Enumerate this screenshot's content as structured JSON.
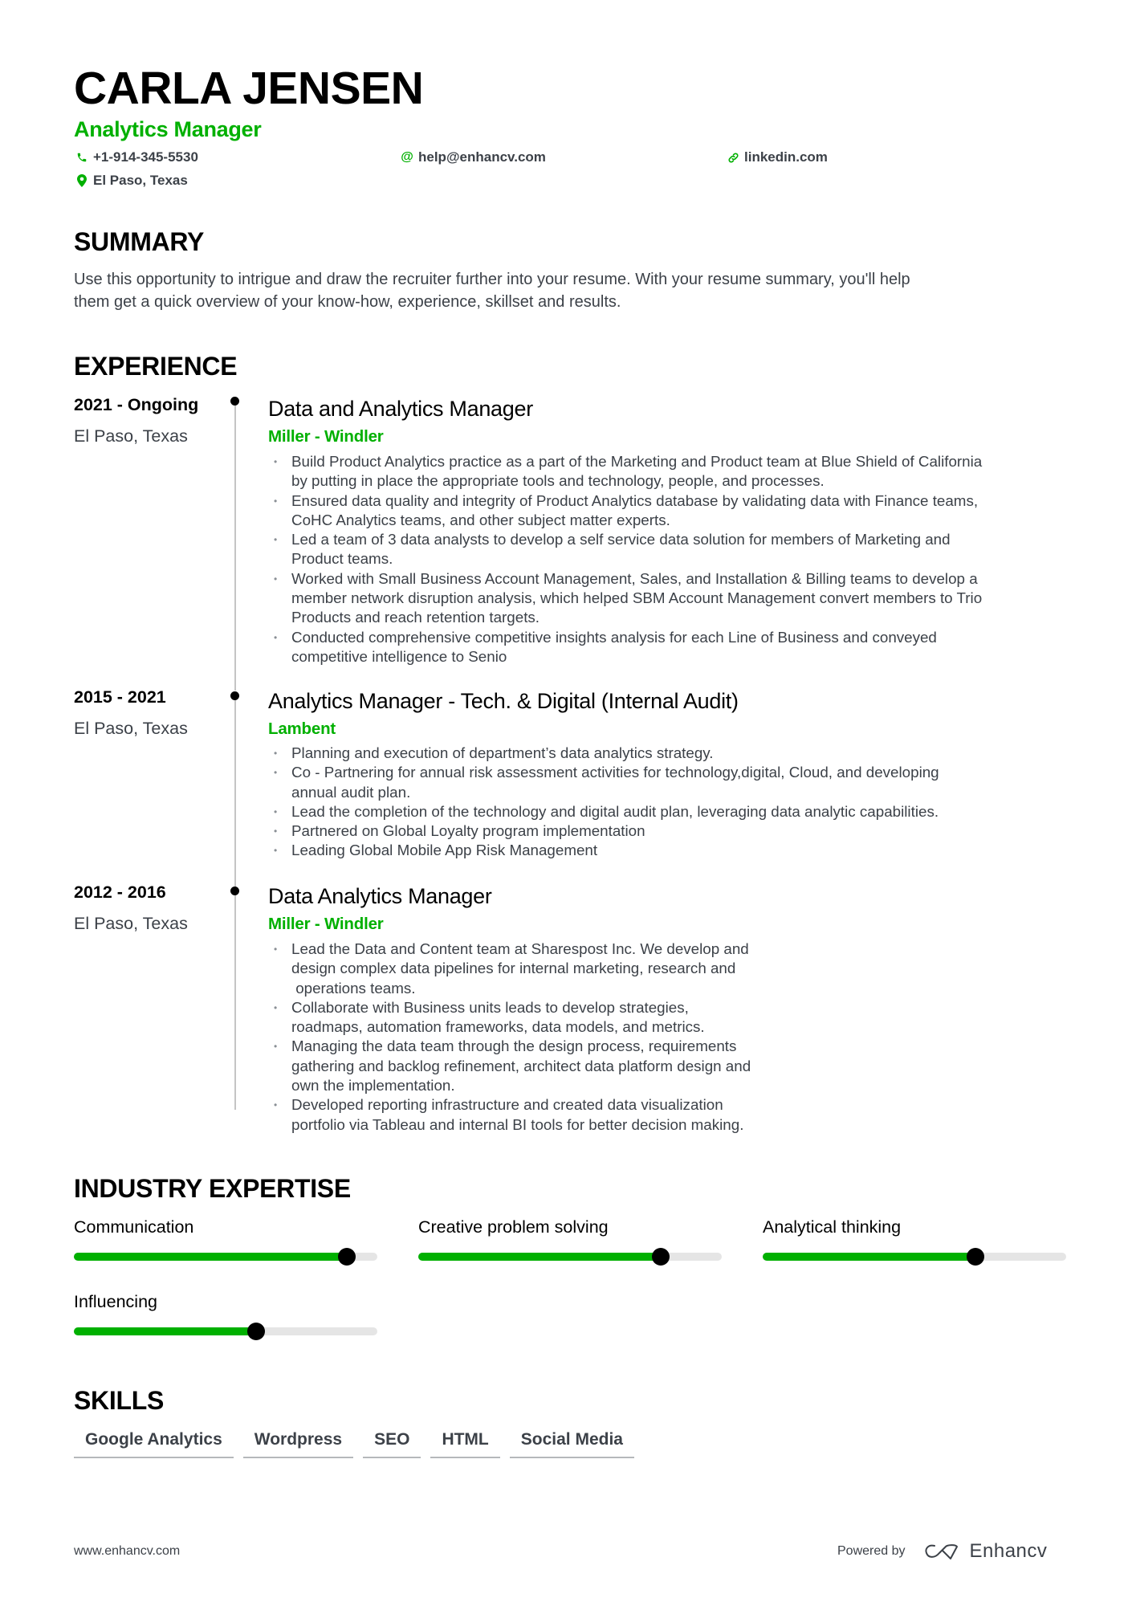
{
  "header": {
    "name": "CARLA JENSEN",
    "title": "Analytics Manager",
    "contacts": {
      "phone": "+1-914-345-5530",
      "email": "help@enhancv.com",
      "linkedin": "linkedin.com",
      "location": "El Paso, Texas"
    },
    "icons": {
      "phone": "phone-icon",
      "email": "at-icon",
      "linkedin": "link-icon",
      "location": "map-pin-icon"
    }
  },
  "summary": {
    "heading": "SUMMARY",
    "lines": [
      "Use this opportunity to intrigue and draw the recruiter further into your resume. With your resume summary, you'll help",
      "them get a quick overview of your know-how, experience, skillset and results."
    ]
  },
  "experience": {
    "heading": "EXPERIENCE",
    "items": [
      {
        "dates": "2021 - Ongoing",
        "location": "El Paso, Texas",
        "title": "Data and Analytics Manager",
        "company": "Miller - Windler",
        "bullets": [
          [
            "Build Product Analytics practice as a part of the Marketing and Product team at Blue Shield of California",
            "by putting in place the appropriate tools and technology, people, and processes."
          ],
          [
            "Ensured data quality and integrity of Product Analytics database by validating data with Finance teams,",
            "CoHC Analytics teams, and other subject matter experts."
          ],
          [
            "Led a team of 3 data analysts to develop a self service data solution for members of Marketing and",
            "Product teams."
          ],
          [
            "Worked with Small Business Account Management, Sales, and Installation & Billing teams to develop a",
            "member network disruption analysis, which helped SBM Account Management convert members to Trio",
            "Products and reach retention targets."
          ],
          [
            "Conducted comprehensive competitive insights analysis for each Line of Business and conveyed",
            "competitive intelligence to Senio"
          ]
        ]
      },
      {
        "dates": "2015 - 2021",
        "location": "El Paso, Texas",
        "title": "Analytics Manager - Tech. & Digital (Internal Audit)",
        "company": "Lambent",
        "bullets": [
          [
            "Planning and execution of department’s data analytics strategy."
          ],
          [
            "Co - Partnering for annual risk assessment activities for technology,digital, Cloud, and developing",
            "annual audit plan."
          ],
          [
            "Lead the completion of the technology and digital audit plan, leveraging data analytic capabilities."
          ],
          [
            "Partnered on Global Loyalty program implementation"
          ],
          [
            "Leading Global Mobile App Risk Management"
          ]
        ]
      },
      {
        "dates": "2012 - 2016",
        "location": "El Paso, Texas",
        "title": "Data Analytics Manager",
        "company": "Miller - Windler",
        "bullets": [
          [
            "Lead the Data and Content team at Sharespost Inc. We develop and",
            "design complex data pipelines for internal marketing, research and",
            " operations teams."
          ],
          [
            "Collaborate with Business units leads to develop strategies,",
            "roadmaps, automation frameworks, data models, and metrics."
          ],
          [
            "Managing the data team through the design process, requirements",
            "gathering and backlog refinement, architect data platform design and",
            "own the implementation."
          ],
          [
            "Developed reporting infrastructure and created data visualization",
            "portfolio via Tableau and internal BI tools for better decision making."
          ]
        ]
      }
    ]
  },
  "expertise": {
    "heading": "INDUSTRY EXPERTISE",
    "items": [
      {
        "label": "Communication",
        "level": 0.9
      },
      {
        "label": "Creative problem solving",
        "level": 0.8
      },
      {
        "label": "Analytical thinking",
        "level": 0.7
      },
      {
        "label": "Influencing",
        "level": 0.6
      }
    ]
  },
  "skills": {
    "heading": "SKILLS",
    "tags": [
      "Google Analytics",
      "Wordpress",
      "SEO",
      "HTML",
      "Social Media"
    ]
  },
  "footer": {
    "website": "www.enhancv.com",
    "powered_by": "Powered by",
    "brand": "Enhancv"
  },
  "colors": {
    "accent": "#00b000",
    "text": "#3c4148",
    "heading": "#000000",
    "track": "#e5e5e5"
  }
}
